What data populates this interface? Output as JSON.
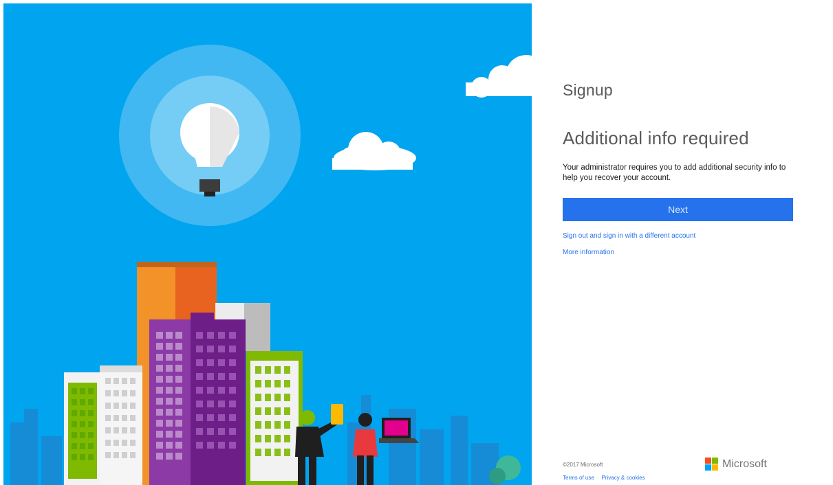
{
  "signup": {
    "heading": "Signup",
    "subheading": "Additional info required",
    "description": "Your administrator requires you to add additional security info to help you recover your account.",
    "next_label": "Next",
    "signout_link": "Sign out and sign in with a different account",
    "more_info_link": "More information"
  },
  "footer": {
    "copyright": "©2017 Microsoft",
    "terms": "Terms of use",
    "privacy": "Privacy & cookies",
    "brand": "Microsoft"
  },
  "colors": {
    "hero_blue": "#01a4ef",
    "button_blue": "#2672ec",
    "logo_red": "#f25022",
    "logo_green": "#7fba00",
    "logo_blue": "#00a4ef",
    "logo_yellow": "#ffb900"
  },
  "icons": {
    "hero": "city-lightbulb-illustration",
    "brand": "microsoft-logo"
  }
}
